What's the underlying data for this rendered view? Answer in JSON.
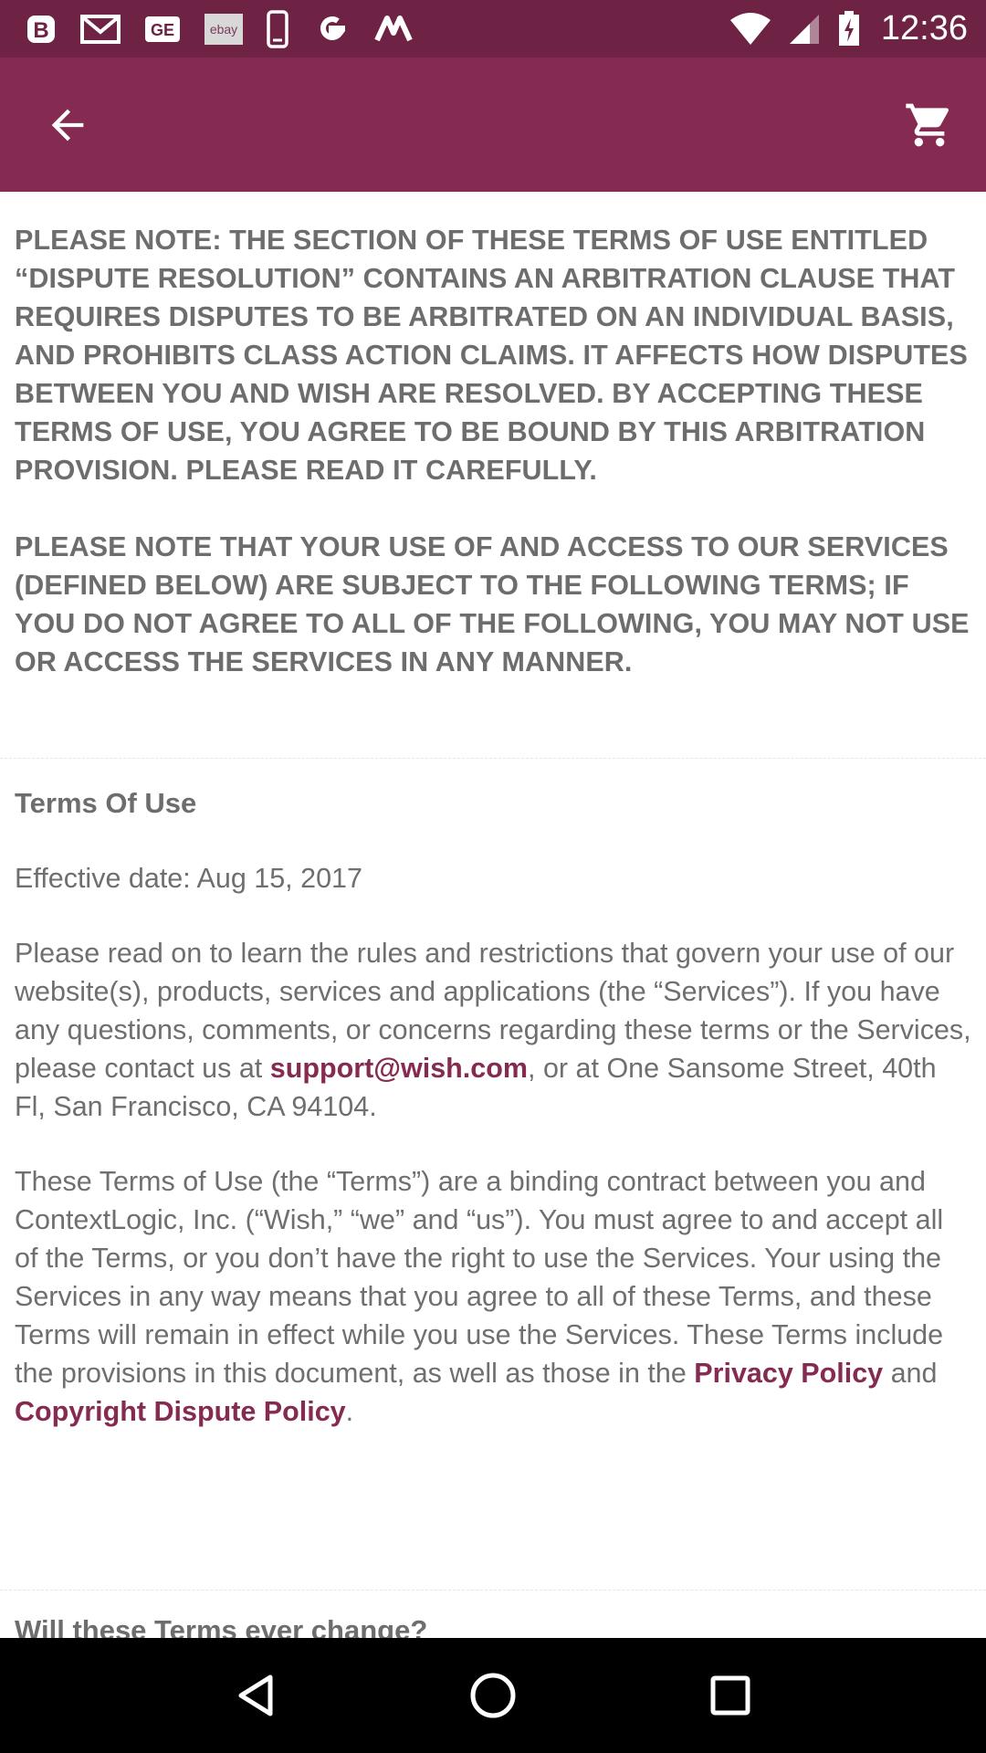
{
  "status_bar": {
    "time": "12:36",
    "notification_icons": [
      "b-icon",
      "gmail-icon",
      "ge-icon",
      "ebay-icon",
      "phone-icon",
      "google-icon",
      "m-icon"
    ],
    "ebay_label": "ebay"
  },
  "app_bar": {
    "back_icon": "arrow-back-icon",
    "cart_icon": "shopping-cart-icon",
    "bg_color": "#852a50"
  },
  "notice": {
    "paragraph_1": "PLEASE NOTE: THE SECTION OF THESE TERMS OF USE ENTITLED “DISPUTE RESOLUTION” CONTAINS AN ARBITRATION CLAUSE THAT REQUIRES DISPUTES TO BE ARBITRATED ON AN INDIVIDUAL BASIS, AND PROHIBITS CLASS ACTION CLAIMS. IT AFFECTS HOW DISPUTES BETWEEN YOU AND WISH ARE RESOLVED. BY ACCEPTING THESE TERMS OF USE, YOU AGREE TO BE BOUND BY THIS ARBITRATION PROVISION. PLEASE READ IT CAREFULLY.",
    "paragraph_2": "PLEASE NOTE THAT YOUR USE OF AND ACCESS TO OUR SERVICES (DEFINED BELOW) ARE SUBJECT TO THE FOLLOWING TERMS; IF YOU DO NOT AGREE TO ALL OF THE FOLLOWING, YOU MAY NOT USE OR ACCESS THE SERVICES IN ANY MANNER."
  },
  "terms": {
    "heading": "Terms Of Use",
    "effective_date": "Effective date: Aug 15, 2017",
    "p1_text": "Please read on to learn the rules and restrictions that govern your use of our website(s), products, services and applications (the “Services”). If you have any questions, comments, or concerns regarding these terms or the Services, please contact us at ",
    "p1_link": "support@wish.com",
    "p1_tail": ", or at One Sansome Street, 40th Fl, San Francisco, CA 94104.",
    "p2_text": "These Terms of Use (the “Terms”) are a binding contract between you and ContextLogic, Inc. (“Wish,” “we” and “us”). You must agree to and accept all of the Terms, or you don’t have the right to use the Services. Your using the Services in any way means that you agree to all of these Terms, and these Terms will remain in effect while you use the Services. These Terms include the provisions in this document, as well as those in the ",
    "p2_link1": "Privacy Policy",
    "p2_mid": " and ",
    "p2_link2": "Copyright Dispute Policy",
    "p2_tail": "."
  },
  "next_section": {
    "heading": "Will these Terms ever change?"
  },
  "nav_bar": {
    "back_icon": "nav-back-icon",
    "home_icon": "nav-home-icon",
    "recents_icon": "nav-recents-icon"
  }
}
